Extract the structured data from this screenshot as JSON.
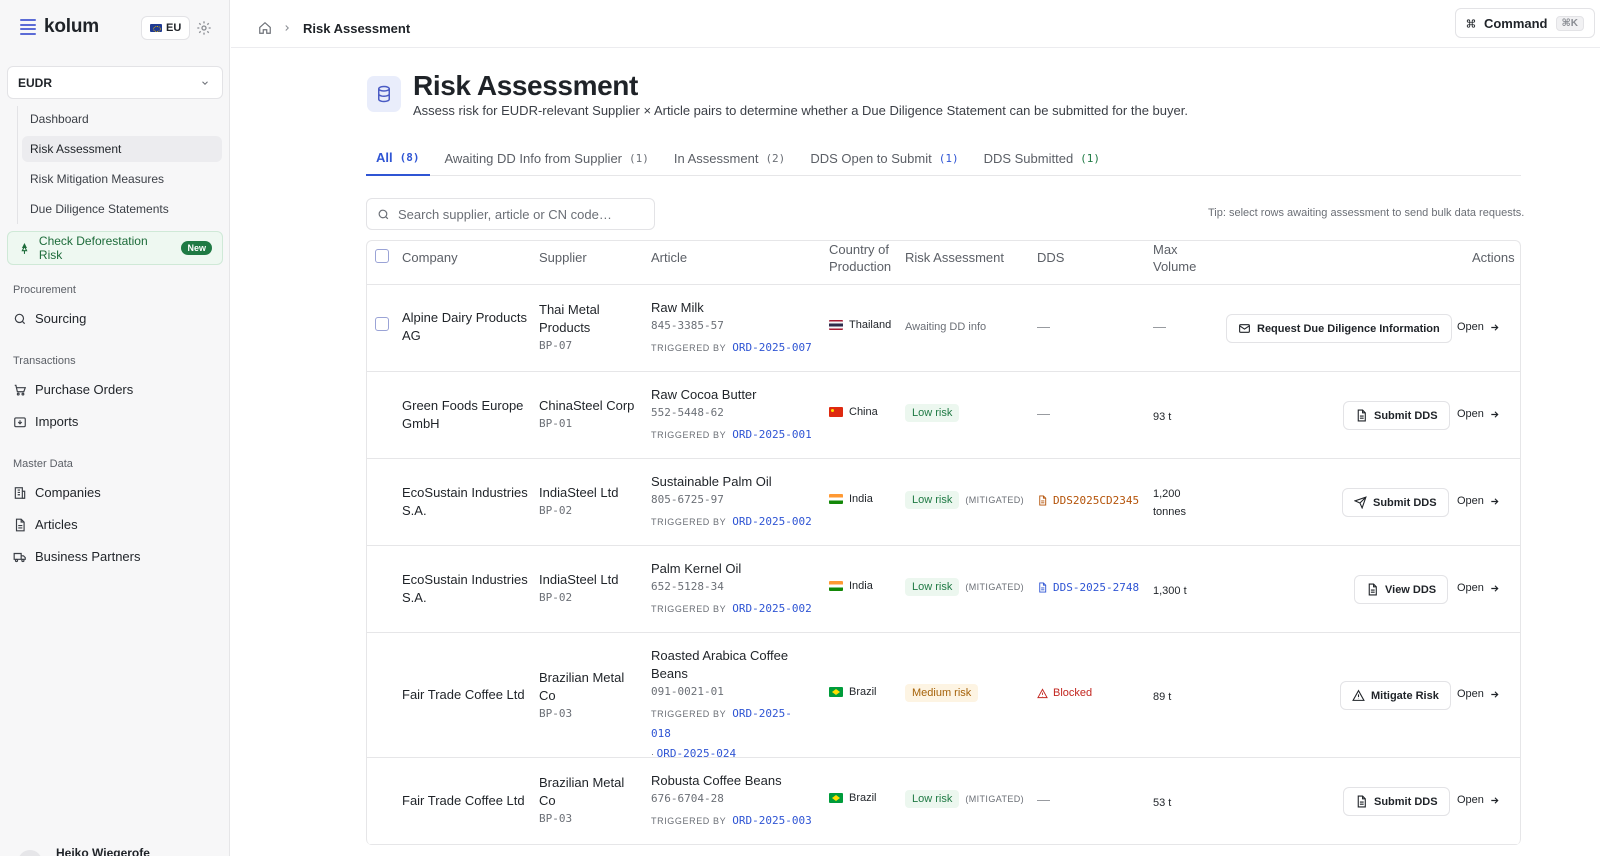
{
  "app": {
    "name": "kolum",
    "region": "EU"
  },
  "sidebar": {
    "module": "EUDR",
    "subnav": [
      {
        "label": "Dashboard",
        "active": false
      },
      {
        "label": "Risk Assessment",
        "active": true
      },
      {
        "label": "Risk Mitigation Measures",
        "active": false
      },
      {
        "label": "Due Diligence Statements",
        "active": false
      }
    ],
    "check_risk": {
      "label": "Check Deforestation Risk",
      "badge": "New"
    },
    "sections": [
      {
        "title": "Procurement",
        "items": [
          {
            "label": "Sourcing",
            "icon": "search-icon"
          }
        ]
      },
      {
        "title": "Transactions",
        "items": [
          {
            "label": "Purchase Orders",
            "icon": "cart-icon"
          },
          {
            "label": "Imports",
            "icon": "import-icon"
          }
        ]
      },
      {
        "title": "Master Data",
        "items": [
          {
            "label": "Companies",
            "icon": "building-icon"
          },
          {
            "label": "Articles",
            "icon": "document-icon"
          },
          {
            "label": "Business Partners",
            "icon": "truck-icon"
          }
        ]
      }
    ],
    "user_name": "Heiko Wiegerofe"
  },
  "topbar": {
    "breadcrumb_current": "Risk Assessment",
    "command_label": "Command",
    "command_shortcut": "⌘K"
  },
  "page": {
    "title": "Risk Assessment",
    "subtitle": "Assess risk for EUDR-relevant Supplier × Article pairs to determine whether a Due Diligence Statement can be submitted for the buyer."
  },
  "tabs": [
    {
      "label": "All",
      "count": "(8)",
      "active": true
    },
    {
      "label": "Awaiting DD Info from Supplier",
      "count": "(1)"
    },
    {
      "label": "In Assessment",
      "count": "(2)"
    },
    {
      "label": "DDS Open to Submit",
      "count": "(1)"
    },
    {
      "label": "DDS Submitted",
      "count": "(1)"
    }
  ],
  "search": {
    "placeholder": "Search supplier, article or CN code…"
  },
  "tip": "Tip: select rows awaiting assessment to send bulk data requests.",
  "table": {
    "columns": {
      "company": "Company",
      "supplier": "Supplier",
      "article": "Article",
      "country_line1": "Country of",
      "country_line2": "Production",
      "risk": "Risk Assessment",
      "dds": "DDS",
      "volume_line1": "Max",
      "volume_line2": "Volume",
      "actions": "Actions"
    },
    "triggered_label": "TRIGGERED BY",
    "mitigated_label": "(MITIGATED)",
    "open_label": "Open",
    "rows": [
      {
        "company": "Alpine Dairy Products AG",
        "supplier": "Thai Metal Products",
        "bp": "BP-07",
        "article": "Raw Milk",
        "cn": "845-3385-57",
        "orders": [
          "ORD-2025-007"
        ],
        "country": "Thailand",
        "risk": "Awaiting DD info",
        "dds": "—",
        "volume": "—",
        "action": "Request Due Diligence Information"
      },
      {
        "company": "Green Foods Europe GmbH",
        "supplier": "ChinaSteel Corp",
        "bp": "BP-01",
        "article": "Raw Cocoa Butter",
        "cn": "552-5448-62",
        "orders": [
          "ORD-2025-001"
        ],
        "country": "China",
        "risk": "Low risk",
        "dds": "—",
        "volume": "93 t",
        "action": "Submit DDS"
      },
      {
        "company": "EcoSustain Industries S.A.",
        "supplier": "IndiaSteel Ltd",
        "bp": "BP-02",
        "article": "Sustainable Palm Oil",
        "cn": "805-6725-97",
        "orders": [
          "ORD-2025-002"
        ],
        "country": "India",
        "risk": "Low risk",
        "dds": "DDS2025CD2345",
        "volume": "1,200 tonnes",
        "action": "Submit DDS"
      },
      {
        "company": "EcoSustain Industries S.A.",
        "supplier": "IndiaSteel Ltd",
        "bp": "BP-02",
        "article": "Palm Kernel Oil",
        "cn": "652-5128-34",
        "orders": [
          "ORD-2025-002"
        ],
        "country": "India",
        "risk": "Low risk",
        "dds": "DDS-2025-2748",
        "volume": "1,300 t",
        "action": "View DDS"
      },
      {
        "company": "Fair Trade Coffee Ltd",
        "supplier": "Brazilian Metal Co",
        "bp": "BP-03",
        "article": "Roasted Arabica Coffee Beans",
        "cn": "091-0021-01",
        "orders": [
          "ORD-2025-018",
          "ORD-2025-024"
        ],
        "country": "Brazil",
        "risk": "Medium risk",
        "dds": "Blocked",
        "volume": "89 t",
        "action": "Mitigate Risk"
      },
      {
        "company": "Fair Trade Coffee Ltd",
        "supplier": "Brazilian Metal Co",
        "bp": "BP-03",
        "article": "Robusta Coffee Beans",
        "cn": "676-6704-28",
        "orders": [
          "ORD-2025-003"
        ],
        "country": "Brazil",
        "risk": "Low risk",
        "dds": "—",
        "volume": "53 t",
        "action": "Submit DDS"
      }
    ]
  },
  "colors": {
    "accent": "#2f55d4",
    "success": "#1f7a44",
    "warning": "#a5620a",
    "danger": "#c2261f"
  }
}
